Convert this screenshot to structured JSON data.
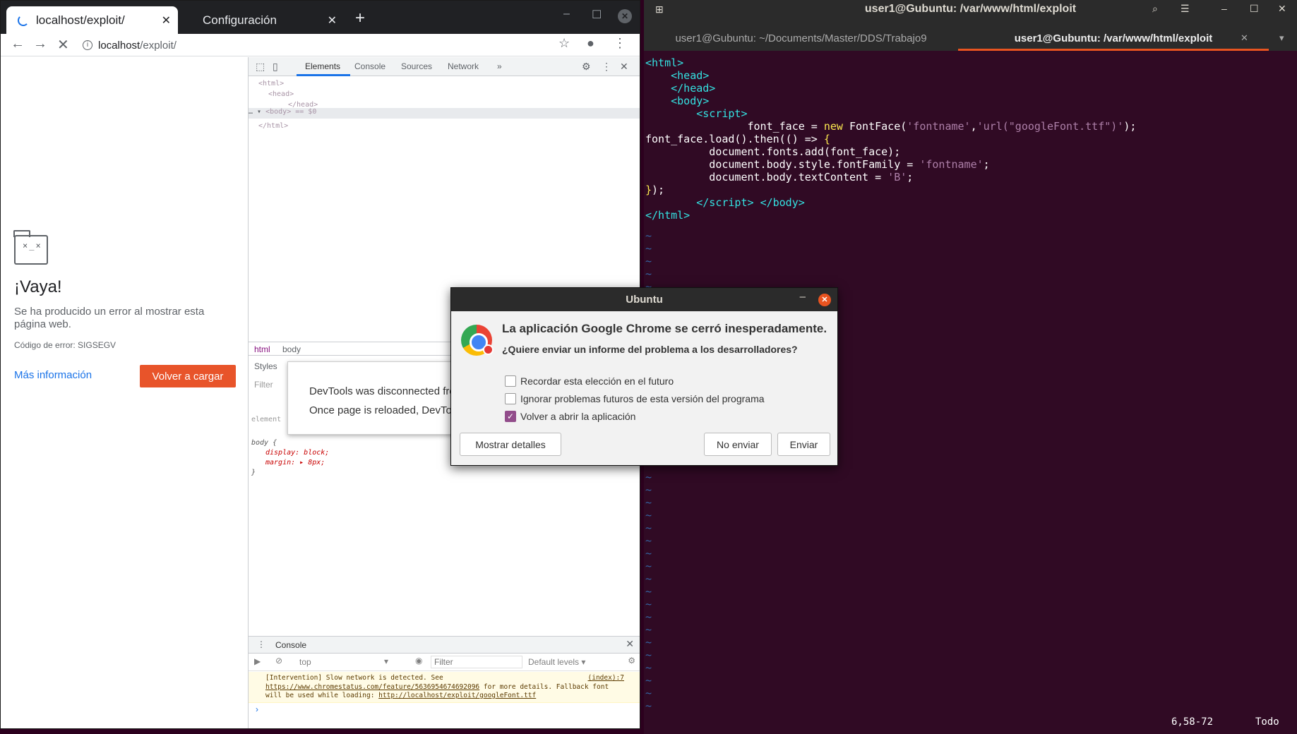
{
  "browser": {
    "tabs": [
      {
        "title": "localhost/exploit/",
        "loading": true
      },
      {
        "title": "Configuración"
      }
    ],
    "url": {
      "host": "localhost",
      "path": "/exploit/"
    }
  },
  "error_page": {
    "title": "¡Vaya!",
    "description": "Se ha producido un error al mostrar esta página web.",
    "error_code": "Código de error: SIGSEGV",
    "more_info": "Más información",
    "reload": "Volver a cargar"
  },
  "devtools": {
    "tabs": [
      "Elements",
      "Console",
      "Sources",
      "Network"
    ],
    "overflow": "»",
    "dom": [
      "<html>",
      "<head>",
      "</head>",
      "</html>"
    ],
    "dom_body": "<body> == $0",
    "breadcrumbs": [
      "html",
      "body"
    ],
    "styles_tab": "Styles",
    "filter_placeholder": "Filter",
    "element_label": "element",
    "css_selector": "body {",
    "css_props": [
      "display: block;",
      "margin: ▸ 8px;"
    ],
    "css_close": "}",
    "disconnected": {
      "line1": "DevTools was disconnected from",
      "line2": "Once page is reloaded, DevTools"
    },
    "console": {
      "tab": "Console",
      "context": "top",
      "filter_placeholder": "Filter",
      "levels": "Default levels ▾",
      "message": {
        "prefix": "[Intervention] Slow network is detected. See ",
        "link1": "https://www.chromestatus.com/feature/5636954674692096",
        "middle": " for more details. Fallback font will be used while loading: ",
        "link2": "http://localhost/exploit/googleFont.ttf",
        "source": "(index):7"
      },
      "prompt": "›"
    }
  },
  "terminal": {
    "window_title": "user1@Gubuntu: /var/www/html/exploit",
    "tabs": [
      "user1@Gubuntu: ~/Documents/Master/DDS/Trabajo9",
      "user1@Gubuntu: /var/www/html/exploit"
    ],
    "status_position": "6,58-72",
    "status_scroll": "Todo"
  },
  "crash_dialog": {
    "title": "Ubuntu",
    "heading": "La aplicación Google Chrome se cerró inesperadamente.",
    "question": "¿Quiere enviar un informe del problema a los desarrolladores?",
    "options": [
      {
        "label": "Recordar esta elección en el futuro",
        "checked": false
      },
      {
        "label": "Ignorar problemas futuros de esta versión del programa",
        "checked": false
      },
      {
        "label": "Volver a abrir la aplicación",
        "checked": true
      }
    ],
    "buttons": {
      "details": "Mostrar detalles",
      "dont_send": "No enviar",
      "send": "Enviar"
    }
  },
  "colors": {
    "accent": "#e95420",
    "terminal_bg": "#300a24",
    "reload_button": "#e8542a",
    "link": "#1a73e8"
  }
}
